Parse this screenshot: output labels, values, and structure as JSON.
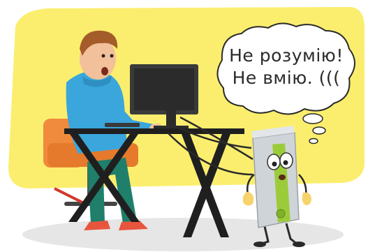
{
  "speech_bubble": {
    "line1": "Не розумію!",
    "line2": "Не вмію. ((("
  },
  "colors": {
    "background_yellow": "#fbee6e",
    "floor_shadow": "#e6e6e6",
    "hoodie_blue": "#3aa6dc",
    "pants_green": "#1f7f6a",
    "chair_orange": "#f08a3c",
    "desk_black": "#1f1f1f",
    "pc_case_green": "#9ccb3a",
    "pc_case_silver": "#cfd4d8",
    "cable_black": "#2a2a2a"
  },
  "icons": [
    "person-icon",
    "monitor-icon",
    "desk-icon",
    "chair-icon",
    "computer-case-character-icon",
    "thought-bubble-icon"
  ]
}
